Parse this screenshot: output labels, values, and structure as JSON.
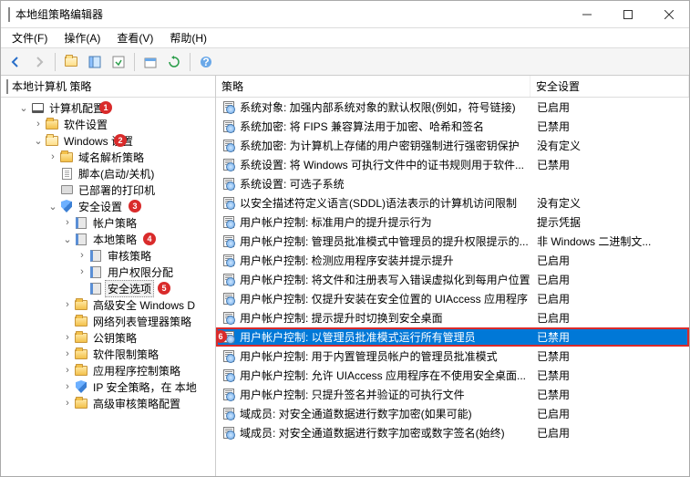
{
  "window": {
    "title": "本地组策略编辑器"
  },
  "menu": {
    "file": "文件(F)",
    "action": "操作(A)",
    "view": "查看(V)",
    "help": "帮助(H)"
  },
  "tree": {
    "root": "本地计算机 策略",
    "items": [
      {
        "label": "计算机配置",
        "depth": 1,
        "open": true,
        "icon": "comp",
        "badge": 1
      },
      {
        "label": "软件设置",
        "depth": 2,
        "open": false,
        "icon": "folder"
      },
      {
        "label": "Windows 设置",
        "depth": 2,
        "open": true,
        "icon": "folder-o",
        "badge": 2
      },
      {
        "label": "域名解析策略",
        "depth": 3,
        "open": false,
        "icon": "folder"
      },
      {
        "label": "脚本(启动/关机)",
        "depth": 3,
        "open": null,
        "icon": "doc"
      },
      {
        "label": "已部署的打印机",
        "depth": 3,
        "open": null,
        "icon": "printer"
      },
      {
        "label": "安全设置",
        "depth": 3,
        "open": true,
        "icon": "shield",
        "badge": 3
      },
      {
        "label": "帐户策略",
        "depth": 4,
        "open": false,
        "icon": "book"
      },
      {
        "label": "本地策略",
        "depth": 4,
        "open": true,
        "icon": "book",
        "badge": 4
      },
      {
        "label": "审核策略",
        "depth": 5,
        "open": false,
        "icon": "book"
      },
      {
        "label": "用户权限分配",
        "depth": 5,
        "open": false,
        "icon": "book"
      },
      {
        "label": "安全选项",
        "depth": 5,
        "open": null,
        "icon": "book",
        "badge": 5,
        "selected": true
      },
      {
        "label": "高级安全 Windows D",
        "depth": 4,
        "open": false,
        "icon": "folder"
      },
      {
        "label": "网络列表管理器策略",
        "depth": 4,
        "open": null,
        "icon": "folder"
      },
      {
        "label": "公钥策略",
        "depth": 4,
        "open": false,
        "icon": "folder"
      },
      {
        "label": "软件限制策略",
        "depth": 4,
        "open": false,
        "icon": "folder"
      },
      {
        "label": "应用程序控制策略",
        "depth": 4,
        "open": false,
        "icon": "folder"
      },
      {
        "label": "IP 安全策略，在 本地",
        "depth": 4,
        "open": false,
        "icon": "shield"
      },
      {
        "label": "高级审核策略配置",
        "depth": 4,
        "open": false,
        "icon": "folder"
      }
    ]
  },
  "list": {
    "col_policy": "策略",
    "col_setting": "安全设置",
    "rows": [
      {
        "policy": "系统对象: 加强内部系统对象的默认权限(例如，符号链接)",
        "setting": "已启用"
      },
      {
        "policy": "系统加密: 将 FIPS 兼容算法用于加密、哈希和签名",
        "setting": "已禁用"
      },
      {
        "policy": "系统加密: 为计算机上存储的用户密钥强制进行强密钥保护",
        "setting": "没有定义"
      },
      {
        "policy": "系统设置: 将 Windows 可执行文件中的证书规则用于软件...",
        "setting": "已禁用"
      },
      {
        "policy": "系统设置: 可选子系统",
        "setting": ""
      },
      {
        "policy": "以安全描述符定义语言(SDDL)语法表示的计算机访问限制",
        "setting": "没有定义"
      },
      {
        "policy": "用户帐户控制: 标准用户的提升提示行为",
        "setting": "提示凭据"
      },
      {
        "policy": "用户帐户控制: 管理员批准模式中管理员的提升权限提示的...",
        "setting": "非 Windows 二进制文..."
      },
      {
        "policy": "用户帐户控制: 检测应用程序安装并提示提升",
        "setting": "已启用"
      },
      {
        "policy": "用户帐户控制: 将文件和注册表写入错误虚拟化到每用户位置",
        "setting": "已启用"
      },
      {
        "policy": "用户帐户控制: 仅提升安装在安全位置的 UIAccess 应用程序",
        "setting": "已启用"
      },
      {
        "policy": "用户帐户控制: 提示提升时切换到安全桌面",
        "setting": "已启用"
      },
      {
        "policy": "用户帐户控制: 以管理员批准模式运行所有管理员",
        "setting": "已禁用",
        "selected": true,
        "highlight": true,
        "badge": 6
      },
      {
        "policy": "用户帐户控制: 用于内置管理员帐户的管理员批准模式",
        "setting": "已禁用"
      },
      {
        "policy": "用户帐户控制: 允许 UIAccess 应用程序在不使用安全桌面...",
        "setting": "已禁用"
      },
      {
        "policy": "用户帐户控制: 只提升签名并验证的可执行文件",
        "setting": "已禁用"
      },
      {
        "policy": "域成员: 对安全通道数据进行数字加密(如果可能)",
        "setting": "已启用"
      },
      {
        "policy": "域成员: 对安全通道数据进行数字加密或数字签名(始终)",
        "setting": "已启用"
      }
    ]
  }
}
